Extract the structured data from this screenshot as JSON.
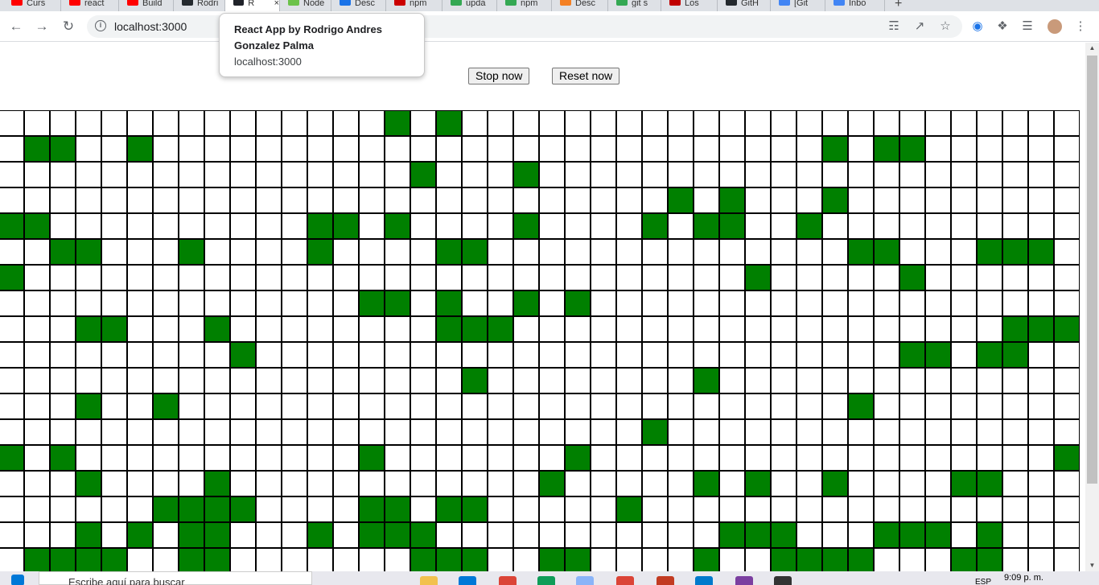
{
  "browser": {
    "tabs": [
      {
        "label": "Curs",
        "color": "#ff0000"
      },
      {
        "label": "react",
        "color": "#ff0000"
      },
      {
        "label": "Build",
        "color": "#ff0000"
      },
      {
        "label": "Rodri",
        "color": "#24292e"
      },
      {
        "label": "R",
        "color": "#20232a",
        "active": true
      },
      {
        "label": "Node",
        "color": "#6cc24a"
      },
      {
        "label": "Desc",
        "color": "#1a73e8"
      },
      {
        "label": "npm",
        "color": "#cb0000"
      },
      {
        "label": "upda",
        "color": "#34a853"
      },
      {
        "label": "npm",
        "color": "#34a853"
      },
      {
        "label": "Desc",
        "color": "#f48024"
      },
      {
        "label": "git s",
        "color": "#34a853"
      },
      {
        "label": "Los",
        "color": "#c00000"
      },
      {
        "label": "GitH",
        "color": "#24292e"
      },
      {
        "label": "[Git",
        "color": "#4285f4"
      },
      {
        "label": "Inbo",
        "color": "#4285f4"
      }
    ],
    "url": "localhost:3000",
    "tooltip": {
      "title": "React App by Rodrigo Andres Gonzalez Palma",
      "url": "localhost:3000"
    }
  },
  "controls": {
    "stop_label": "Stop now",
    "reset_label": "Reset now"
  },
  "grid": {
    "cols": 42,
    "rows": 18,
    "alive_color": "#008000",
    "alive_cells": [
      [
        0,
        15
      ],
      [
        0,
        17
      ],
      [
        1,
        1
      ],
      [
        1,
        2
      ],
      [
        1,
        5
      ],
      [
        1,
        32
      ],
      [
        1,
        34
      ],
      [
        1,
        35
      ],
      [
        2,
        16
      ],
      [
        2,
        20
      ],
      [
        3,
        26
      ],
      [
        3,
        28
      ],
      [
        3,
        32
      ],
      [
        4,
        0
      ],
      [
        4,
        1
      ],
      [
        4,
        12
      ],
      [
        4,
        13
      ],
      [
        4,
        15
      ],
      [
        4,
        20
      ],
      [
        4,
        25
      ],
      [
        4,
        27
      ],
      [
        4,
        28
      ],
      [
        4,
        31
      ],
      [
        5,
        2
      ],
      [
        5,
        3
      ],
      [
        5,
        7
      ],
      [
        5,
        12
      ],
      [
        5,
        17
      ],
      [
        5,
        18
      ],
      [
        5,
        33
      ],
      [
        5,
        34
      ],
      [
        5,
        38
      ],
      [
        5,
        39
      ],
      [
        5,
        40
      ],
      [
        6,
        0
      ],
      [
        6,
        29
      ],
      [
        6,
        35
      ],
      [
        7,
        14
      ],
      [
        7,
        15
      ],
      [
        7,
        17
      ],
      [
        7,
        20
      ],
      [
        7,
        22
      ],
      [
        8,
        3
      ],
      [
        8,
        4
      ],
      [
        8,
        8
      ],
      [
        8,
        17
      ],
      [
        8,
        18
      ],
      [
        8,
        19
      ],
      [
        8,
        39
      ],
      [
        8,
        40
      ],
      [
        8,
        41
      ],
      [
        9,
        9
      ],
      [
        9,
        35
      ],
      [
        9,
        36
      ],
      [
        9,
        38
      ],
      [
        9,
        39
      ],
      [
        10,
        18
      ],
      [
        10,
        27
      ],
      [
        11,
        3
      ],
      [
        11,
        6
      ],
      [
        11,
        33
      ],
      [
        12,
        25
      ],
      [
        13,
        0
      ],
      [
        13,
        2
      ],
      [
        13,
        14
      ],
      [
        13,
        22
      ],
      [
        13,
        41
      ],
      [
        14,
        3
      ],
      [
        14,
        8
      ],
      [
        14,
        21
      ],
      [
        14,
        27
      ],
      [
        14,
        29
      ],
      [
        14,
        32
      ],
      [
        14,
        37
      ],
      [
        14,
        38
      ],
      [
        15,
        6
      ],
      [
        15,
        7
      ],
      [
        15,
        8
      ],
      [
        15,
        9
      ],
      [
        15,
        14
      ],
      [
        15,
        15
      ],
      [
        15,
        17
      ],
      [
        15,
        18
      ],
      [
        15,
        24
      ],
      [
        16,
        3
      ],
      [
        16,
        5
      ],
      [
        16,
        7
      ],
      [
        16,
        8
      ],
      [
        16,
        12
      ],
      [
        16,
        14
      ],
      [
        16,
        15
      ],
      [
        16,
        16
      ],
      [
        16,
        28
      ],
      [
        16,
        29
      ],
      [
        16,
        30
      ],
      [
        16,
        34
      ],
      [
        16,
        35
      ],
      [
        16,
        36
      ],
      [
        16,
        38
      ],
      [
        17,
        1
      ],
      [
        17,
        2
      ],
      [
        17,
        3
      ],
      [
        17,
        4
      ],
      [
        17,
        7
      ],
      [
        17,
        8
      ],
      [
        17,
        16
      ],
      [
        17,
        17
      ],
      [
        17,
        18
      ],
      [
        17,
        21
      ],
      [
        17,
        22
      ],
      [
        17,
        27
      ],
      [
        17,
        30
      ],
      [
        17,
        31
      ],
      [
        17,
        32
      ],
      [
        17,
        33
      ],
      [
        17,
        37
      ],
      [
        17,
        38
      ]
    ]
  },
  "taskbar": {
    "search_placeholder": "Escribe aquí para buscar",
    "lang": "ESP",
    "clock": "9:09 p. m."
  }
}
